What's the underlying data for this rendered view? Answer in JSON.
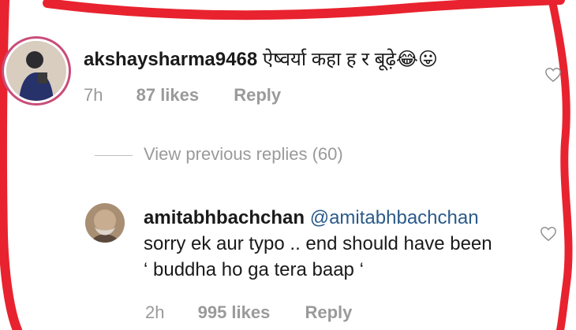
{
  "comment": {
    "username": "akshaysharma9468",
    "text": "ऐष्वर्या कहा ह र बूढ़े😂😛",
    "time": "7h",
    "likes": "87 likes",
    "reply_label": "Reply"
  },
  "view_previous_replies": "View previous replies (60)",
  "reply": {
    "username": "amitabhbachchan",
    "mention": "@amitabhbachchan",
    "line1": "sorry ek aur typo .. end should have been",
    "line2": "‘ buddha ho ga tera baap ‘",
    "time": "2h",
    "likes": "995 likes",
    "reply_label": "Reply"
  },
  "icons": [
    "heart-icon"
  ],
  "colors": {
    "annotation_stroke": "#e8232f",
    "meta_text": "#9a9a9a",
    "mention": "#2a5a8a",
    "story_ring": "#c84d7a"
  }
}
